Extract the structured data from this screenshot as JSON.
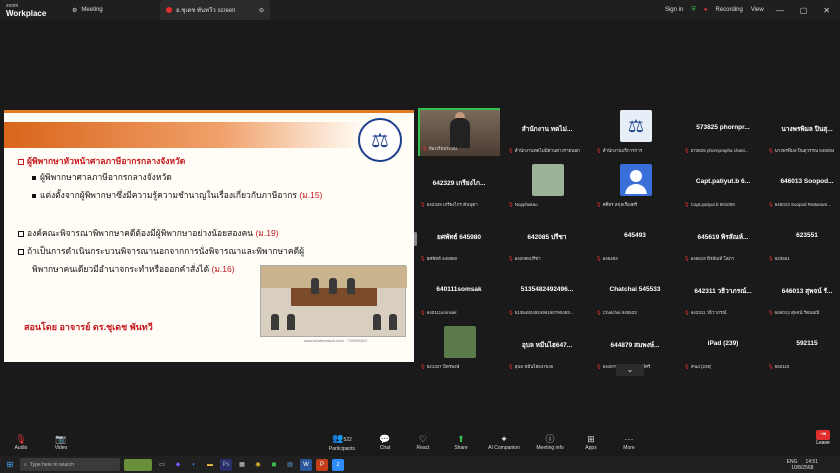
{
  "titlebar": {
    "logo_small": "zoom",
    "logo_large": "Workplace",
    "tab_meeting": "Meeting",
    "tab_share": "อ.ชุเดช พันทวีว screen",
    "sign_in": "Sign in",
    "recording": "Recording",
    "view": "View"
  },
  "slide": {
    "line1": "ผู้พิพากษาหัวหน้าศาลภาษีอากรกลางจังหวัด",
    "line2": "ผู้พิพากษาศาลภาษีอากรกลางจังหวัด",
    "line3": "แต่งตั้งจากผู้พิพากษาซึ่งมีความรู้ความชำนาญในเรื่องเกี่ยวกับภาษีอากร",
    "line3_ref": "(ม.15)",
    "line4": "องค์คณะพิจารณาพิพากษาคดีต้องมีผู้พิพากษาอย่างน้อยสองคน",
    "line4_ref": "(ม.19)",
    "line5": "ถ้าเป็นการดำเนินกระบวนพิจารณานอกจากการนั่งพิจารณาและพิพากษาคดีผู้",
    "line6": "พิพากษาคนเดียวมีอำนาจกระทำหรือออกคำสั่งได้",
    "line6_ref": "(ม.16)",
    "author": "สอนโดย อาจารย์ ดร.ชุเดช พันทวี",
    "url": "www.shutterstock.com · 732999312"
  },
  "gallery": [
    {
      "name": "",
      "sub": "ห้องเรียนระบบ",
      "kind": "video",
      "active": true
    },
    {
      "name": "สำนักงาน ทดไม่...",
      "sub": "สำนักงานทดไม่มีส่วนต่างรายนอก",
      "kind": "name"
    },
    {
      "name": "",
      "sub": "สำนักงานบริการการ",
      "kind": "photo-scales"
    },
    {
      "name": "573825 phornpr...",
      "sub": "573825 phornprapha chant...",
      "kind": "name"
    },
    {
      "name": "นางพรพิมล ปินสุ...",
      "sub": "นางพรพิมล ปินสุวรรณ 645084",
      "kind": "name"
    },
    {
      "name": "642329 เกรียงไก...",
      "sub": "642329 เกรียงไกร คันนุตา",
      "kind": "name"
    },
    {
      "name": "",
      "sub": "Nopphakao",
      "kind": "photo-card"
    },
    {
      "name": "",
      "sub": "ศศิธร สกุลเรืองศรี",
      "kind": "photo-avatar"
    },
    {
      "name": "Capt.patiyut.b 6...",
      "sub": "Capt.patiyut.b 601009",
      "kind": "name"
    },
    {
      "name": "646013 Soopod...",
      "sub": "646013 Soopod Rattanam...",
      "kind": "name"
    },
    {
      "name": "ยศพัทธ์ 645980",
      "sub": "ยศพัทธ์ 645980",
      "kind": "name"
    },
    {
      "name": "642085 ปรีชา",
      "sub": "642085ปรีชา",
      "kind": "name"
    },
    {
      "name": "645493",
      "sub": "645493",
      "kind": "name"
    },
    {
      "name": "645619 พิรสัณห์...",
      "sub": "645619 พิรสัณห์ โสภา",
      "kind": "name"
    },
    {
      "name": "623551",
      "sub": "623551",
      "kind": "name"
    },
    {
      "name": "640111somsak",
      "sub": "640111somsak",
      "kind": "name"
    },
    {
      "name": "5135482492496...",
      "sub": "5135482492496160790493...",
      "kind": "name"
    },
    {
      "name": "Chatchai 545533",
      "sub": "Chatchai 545533",
      "kind": "name"
    },
    {
      "name": "642311 วธิวาภรณ์...",
      "sub": "642311 วธิวาภรณ์",
      "kind": "name"
    },
    {
      "name": "646013 สุพจน์ รั...",
      "sub": "646013 สุพจน์ รัตนมณี",
      "kind": "name"
    },
    {
      "name": "",
      "sub": "621327 มิตรพงษ์",
      "kind": "photo-person"
    },
    {
      "name": "อุบล หมีนไฮ647...",
      "sub": "อุบล หมีนไฮ647546",
      "kind": "name"
    },
    {
      "name": "644879 สมพงษ์...",
      "sub": "644879 สมพงษ์ จันทร์ศรี",
      "kind": "name"
    },
    {
      "name": "iPad (239)",
      "sub": "iPad (239)",
      "kind": "name"
    },
    {
      "name": "592115",
      "sub": "592115",
      "kind": "name"
    }
  ],
  "toolbar": {
    "audio": "Audio",
    "video": "Video",
    "participants": "Participants",
    "participants_count": "522",
    "chat": "Chat",
    "react": "React",
    "share": "Share",
    "ai": "AI Companion",
    "info": "Meeting info",
    "apps": "Apps",
    "more": "More",
    "leave": "Leave"
  },
  "taskbar": {
    "search_placeholder": "Type here to search",
    "lang": "ENG",
    "time": "14:51",
    "date": "10/8/2568"
  }
}
